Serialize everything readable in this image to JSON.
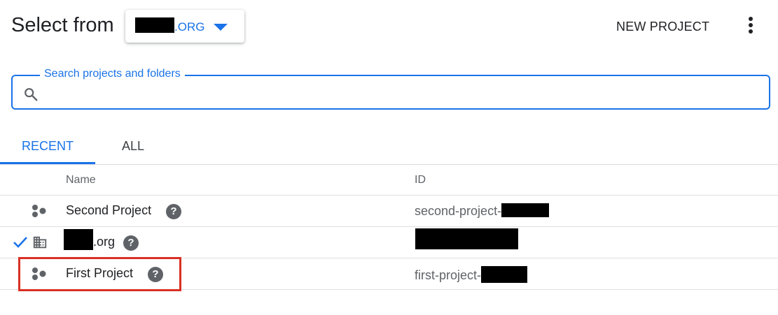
{
  "header": {
    "title": "Select from",
    "org_suffix": ".ORG",
    "new_project_label": "NEW PROJECT",
    "more_icon": "more-vert-icon"
  },
  "search": {
    "legend": "Search projects and folders",
    "value": "",
    "icon": "search-icon"
  },
  "tabs": [
    {
      "label": "RECENT",
      "active": true
    },
    {
      "label": "ALL",
      "active": false
    }
  ],
  "table": {
    "columns": [
      "Name",
      "ID"
    ],
    "rows": [
      {
        "name": "Second Project",
        "id_prefix": "second-project-",
        "icon": "project-icon",
        "selected": false
      },
      {
        "name": ".org",
        "id_prefix": "",
        "icon": "organization-icon",
        "selected": true
      },
      {
        "name": "First Project",
        "id_prefix": "first-project-",
        "icon": "project-icon",
        "selected": false,
        "highlighted": true
      }
    ]
  },
  "colors": {
    "accent": "#1a73e8",
    "highlight": "#d93025"
  }
}
